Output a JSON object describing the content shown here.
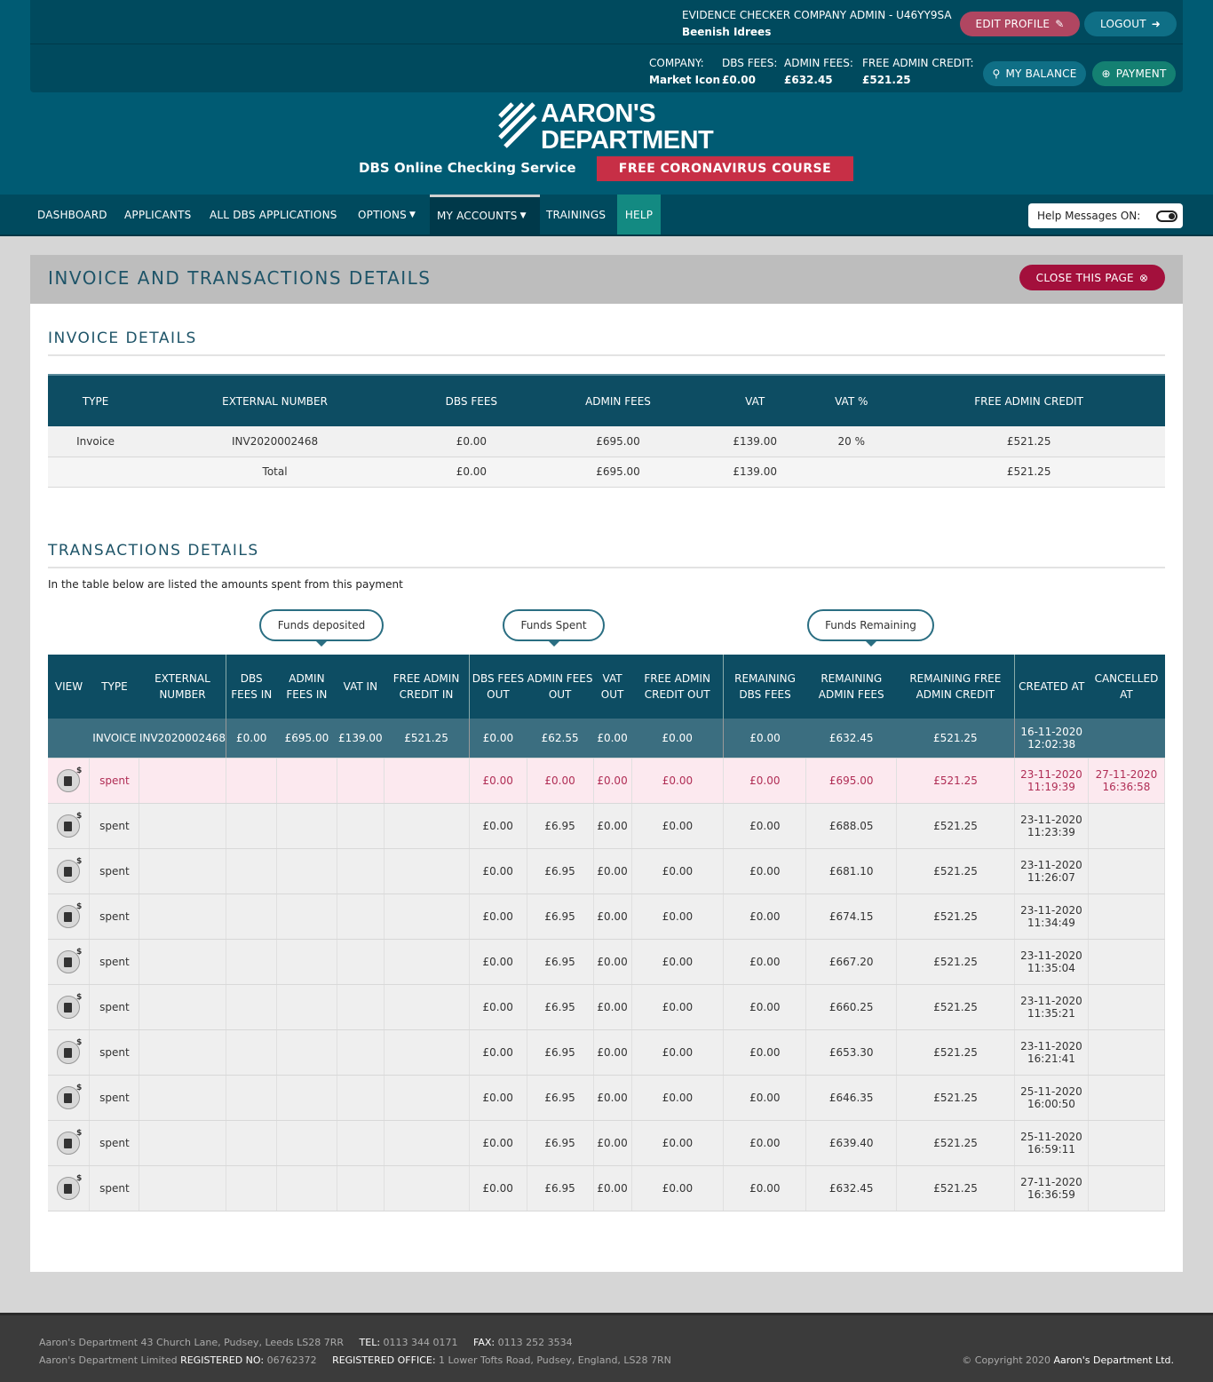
{
  "user": {
    "role": "EVIDENCE CHECKER COMPANY ADMIN - U46YY9SA",
    "name": "Beenish Idrees"
  },
  "buttons": {
    "edit_profile": "EDIT PROFILE",
    "logout": "LOGOUT",
    "my_balance": "MY BALANCE",
    "payment": "PAYMENT",
    "close_page": "CLOSE THIS PAGE"
  },
  "stats": [
    {
      "label": "COMPANY:",
      "value": "Market Icon"
    },
    {
      "label": "DBS FEES:",
      "value": "£0.00"
    },
    {
      "label": "ADMIN FEES:",
      "value": "£632.45"
    },
    {
      "label": "FREE ADMIN CREDIT:",
      "value": "£521.25"
    }
  ],
  "brand": {
    "line1": "AARON'S",
    "line2": "DEPARTMENT",
    "tagline": "DBS Online Checking Service",
    "promo": "FREE CORONAVIRUS COURSE"
  },
  "nav": [
    "DASHBOARD",
    "APPLICANTS",
    "ALL DBS APPLICATIONS",
    "OPTIONS",
    "MY ACCOUNTS",
    "TRAININGS",
    "HELP"
  ],
  "help_messages": "Help Messages ON:",
  "page_title": "INVOICE AND TRANSACTIONS DETAILS",
  "invoice": {
    "title": "INVOICE DETAILS",
    "headers": [
      "TYPE",
      "EXTERNAL NUMBER",
      "DBS FEES",
      "ADMIN FEES",
      "VAT",
      "VAT %",
      "FREE ADMIN CREDIT"
    ],
    "rows": [
      [
        "Invoice",
        "INV2020002468",
        "£0.00",
        "£695.00",
        "£139.00",
        "20 %",
        "£521.25"
      ],
      [
        "",
        "Total",
        "£0.00",
        "£695.00",
        "£139.00",
        "",
        "£521.25"
      ]
    ]
  },
  "transactions": {
    "title": "TRANSACTIONS DETAILS",
    "note": "In the table below are listed the amounts spent from this payment",
    "groups": [
      "Funds deposited",
      "Funds Spent",
      "Funds Remaining"
    ],
    "headers": [
      "VIEW",
      "TYPE",
      "EXTERNAL NUMBER",
      "DBS FEES IN",
      "ADMIN FEES IN",
      "VAT IN",
      "FREE ADMIN CREDIT IN",
      "DBS FEES OUT",
      "ADMIN FEES OUT",
      "VAT OUT",
      "FREE ADMIN CREDIT OUT",
      "REMAINING DBS FEES",
      "REMAINING ADMIN FEES",
      "REMAINING FREE ADMIN CREDIT",
      "CREATED AT",
      "CANCELLED AT"
    ],
    "invoice_row": [
      "",
      "INVOICE",
      "INV2020002468",
      "£0.00",
      "£695.00",
      "£139.00",
      "£521.25",
      "£0.00",
      "£62.55",
      "£0.00",
      "£0.00",
      "£0.00",
      "£632.45",
      "£521.25",
      "16-11-2020 12:02:38",
      ""
    ],
    "rows": [
      [
        "spent",
        "£0.00",
        "£0.00",
        "£0.00",
        "£0.00",
        "£0.00",
        "£695.00",
        "£521.25",
        "23-11-2020 11:19:39",
        "27-11-2020 16:36:58"
      ],
      [
        "spent",
        "£0.00",
        "£6.95",
        "£0.00",
        "£0.00",
        "£0.00",
        "£688.05",
        "£521.25",
        "23-11-2020 11:23:39",
        ""
      ],
      [
        "spent",
        "£0.00",
        "£6.95",
        "£0.00",
        "£0.00",
        "£0.00",
        "£681.10",
        "£521.25",
        "23-11-2020 11:26:07",
        ""
      ],
      [
        "spent",
        "£0.00",
        "£6.95",
        "£0.00",
        "£0.00",
        "£0.00",
        "£674.15",
        "£521.25",
        "23-11-2020 11:34:49",
        ""
      ],
      [
        "spent",
        "£0.00",
        "£6.95",
        "£0.00",
        "£0.00",
        "£0.00",
        "£667.20",
        "£521.25",
        "23-11-2020 11:35:04",
        ""
      ],
      [
        "spent",
        "£0.00",
        "£6.95",
        "£0.00",
        "£0.00",
        "£0.00",
        "£660.25",
        "£521.25",
        "23-11-2020 11:35:21",
        ""
      ],
      [
        "spent",
        "£0.00",
        "£6.95",
        "£0.00",
        "£0.00",
        "£0.00",
        "£653.30",
        "£521.25",
        "23-11-2020 16:21:41",
        ""
      ],
      [
        "spent",
        "£0.00",
        "£6.95",
        "£0.00",
        "£0.00",
        "£0.00",
        "£646.35",
        "£521.25",
        "25-11-2020 16:00:50",
        ""
      ],
      [
        "spent",
        "£0.00",
        "£6.95",
        "£0.00",
        "£0.00",
        "£0.00",
        "£639.40",
        "£521.25",
        "25-11-2020 16:59:11",
        ""
      ],
      [
        "spent",
        "£0.00",
        "£6.95",
        "£0.00",
        "£0.00",
        "£0.00",
        "£632.45",
        "£521.25",
        "27-11-2020 16:36:59",
        ""
      ]
    ]
  },
  "footer": {
    "address": "Aaron's Department 43 Church Lane, Pudsey, Leeds LS28 7RR",
    "tel_label": "TEL:",
    "tel": "0113 344 0171",
    "fax_label": "FAX:",
    "fax": "0113 252 3534",
    "company": "Aaron's Department Limited",
    "reg_label": "REGISTERED NO:",
    "reg": "06762372",
    "office_label": "REGISTERED OFFICE:",
    "office": "1 Lower Tofts Road, Pudsey, England, LS28 7RN",
    "copyright": "© Copyright 2020",
    "copyright_name": "Aaron's Department Ltd."
  }
}
